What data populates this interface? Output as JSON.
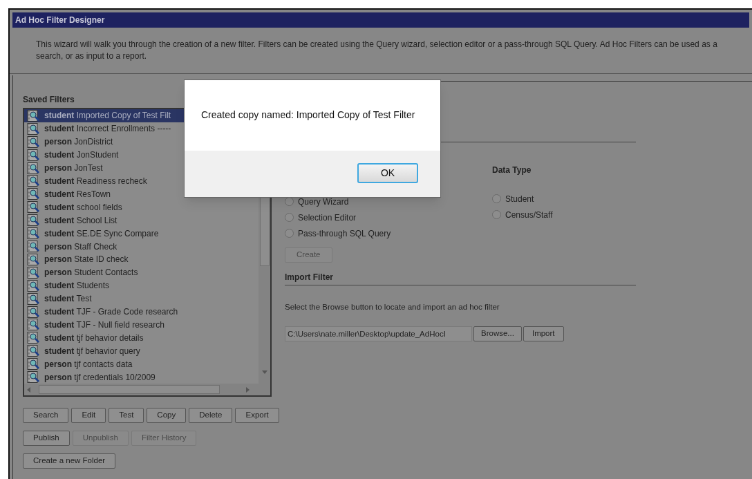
{
  "window": {
    "title": "Ad Hoc Filter Designer"
  },
  "description": "This wizard will walk you through the creation of a new filter. Filters can be created using the Query wizard, selection editor or a pass-through SQL Query. Ad Hoc Filters can be used as a search, or as input to a report.",
  "saved_filters": {
    "heading": "Saved Filters",
    "items": [
      {
        "type": "student",
        "name": "Imported Copy of Test Filt",
        "selected": true
      },
      {
        "type": "student",
        "name": "Incorrect Enrollments -----",
        "selected": false
      },
      {
        "type": "person",
        "name": "JonDistrict",
        "selected": false
      },
      {
        "type": "student",
        "name": "JonStudent",
        "selected": false
      },
      {
        "type": "person",
        "name": "JonTest",
        "selected": false
      },
      {
        "type": "student",
        "name": "Readiness recheck",
        "selected": false
      },
      {
        "type": "student",
        "name": "ResTown",
        "selected": false
      },
      {
        "type": "student",
        "name": "school fields",
        "selected": false
      },
      {
        "type": "student",
        "name": "School List",
        "selected": false
      },
      {
        "type": "student",
        "name": "SE.DE Sync Compare",
        "selected": false
      },
      {
        "type": "person",
        "name": "Staff Check",
        "selected": false
      },
      {
        "type": "person",
        "name": "State ID check",
        "selected": false
      },
      {
        "type": "person",
        "name": "Student Contacts",
        "selected": false
      },
      {
        "type": "student",
        "name": "Students",
        "selected": false
      },
      {
        "type": "student",
        "name": "Test",
        "selected": false
      },
      {
        "type": "student",
        "name": "TJF - Grade Code research",
        "selected": false
      },
      {
        "type": "student",
        "name": "TJF - Null field research",
        "selected": false
      },
      {
        "type": "student",
        "name": "tjf behavior details",
        "selected": false
      },
      {
        "type": "student",
        "name": "tjf behavior query",
        "selected": false
      },
      {
        "type": "person",
        "name": "tjf contacts data",
        "selected": false
      },
      {
        "type": "person",
        "name": "tjf credentials 10/2009",
        "selected": false
      }
    ],
    "button_rows": [
      [
        {
          "label": "Search",
          "disabled": false
        },
        {
          "label": "Edit",
          "disabled": false
        },
        {
          "label": "Test",
          "disabled": false
        },
        {
          "label": "Copy",
          "disabled": false
        },
        {
          "label": "Delete",
          "disabled": false
        },
        {
          "label": "Export",
          "disabled": false
        }
      ],
      [
        {
          "label": "Publish",
          "disabled": false
        },
        {
          "label": "Unpublish",
          "disabled": true
        },
        {
          "label": "Filter History",
          "disabled": true
        }
      ],
      [
        {
          "label": "Create a new Folder",
          "disabled": false
        }
      ]
    ]
  },
  "new_filter": {
    "filter_types": [
      {
        "label": "Query Wizard",
        "selected": false
      },
      {
        "label": "Selection Editor",
        "selected": false
      },
      {
        "label": "Pass-through SQL Query",
        "selected": false
      }
    ],
    "data_type": {
      "heading": "Data Type",
      "options": [
        {
          "label": "Student",
          "selected": false
        },
        {
          "label": "Census/Staff",
          "selected": false
        }
      ]
    },
    "create_button": {
      "label": "Create",
      "disabled": true
    }
  },
  "import_filter": {
    "heading": "Import Filter",
    "instructions": "Select the Browse button to locate and import an ad hoc filter",
    "file_path": "C:\\Users\\nate.miller\\Desktop\\update_AdHocI",
    "browse_button": "Browse...",
    "import_button": "Import"
  },
  "dialog": {
    "message": "Created copy named: Imported Copy of Test Filter",
    "ok_button": "OK"
  }
}
